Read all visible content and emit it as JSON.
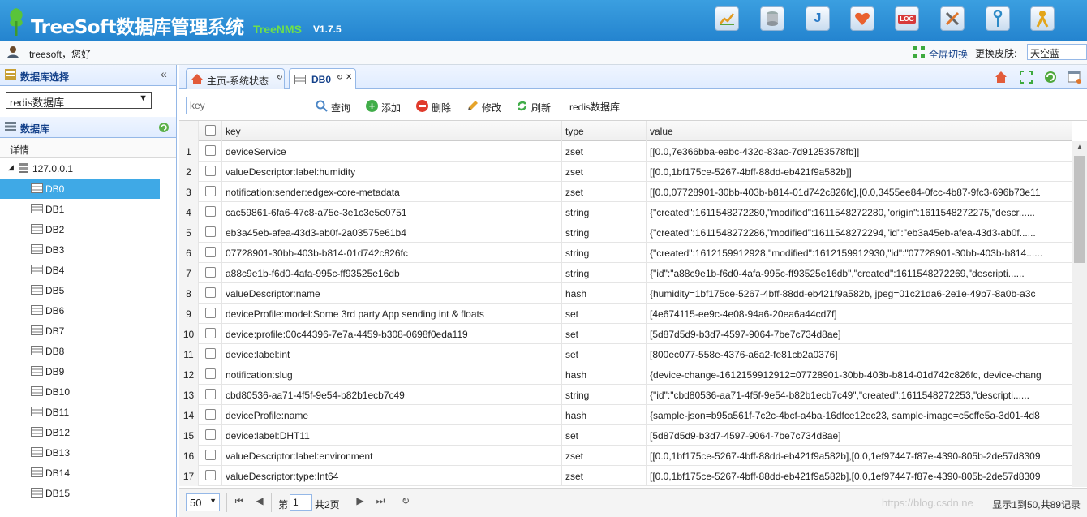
{
  "header": {
    "title": "TreeSoft数据库管理系统",
    "subtitle": "TreeNMS",
    "version": "V1.7.5",
    "toolbar_icons": [
      "chart-icon",
      "database-icon",
      "j-icon",
      "heart-icon",
      "log-icon",
      "tools-icon",
      "key-icon",
      "user-icon"
    ]
  },
  "userbar": {
    "username": "treesoft，您好",
    "fullscreen_label": "全屏切换",
    "skin_label": "更换皮肤:",
    "skin_value": "天空蓝"
  },
  "left": {
    "db_select_title": "数据库选择",
    "db_select_value": "redis数据库",
    "db_panel_title": "数据库",
    "detail_label": "详情",
    "root_node": "127.0.0.1",
    "dbs": [
      "DB0",
      "DB1",
      "DB2",
      "DB3",
      "DB4",
      "DB5",
      "DB6",
      "DB7",
      "DB8",
      "DB9",
      "DB10",
      "DB11",
      "DB12",
      "DB13",
      "DB14",
      "DB15"
    ],
    "selected": "DB0"
  },
  "tabs": [
    {
      "label": "主页-系统状态",
      "icon": "home-icon"
    },
    {
      "label": "DB0",
      "icon": "table-icon"
    }
  ],
  "toolbar": {
    "search_placeholder": "key",
    "query_label": "查询",
    "add_label": "添加",
    "delete_label": "删除",
    "edit_label": "修改",
    "refresh_label": "刷新",
    "db_name": "redis数据库"
  },
  "grid": {
    "columns": [
      "key",
      "type",
      "value"
    ],
    "rows": [
      {
        "n": "1",
        "key": "deviceService",
        "type": "zset",
        "value": "[[0.0,7e366bba-eabc-432d-83ac-7d91253578fb]]"
      },
      {
        "n": "2",
        "key": "valueDescriptor:label:humidity",
        "type": "zset",
        "value": "[[0.0,1bf175ce-5267-4bff-88dd-eb421f9a582b]]"
      },
      {
        "n": "3",
        "key": "notification:sender:edgex-core-metadata",
        "type": "zset",
        "value": "[[0.0,07728901-30bb-403b-b814-01d742c826fc],[0.0,3455ee84-0fcc-4b87-9fc3-696b73e11"
      },
      {
        "n": "4",
        "key": "cac59861-6fa6-47c8-a75e-3e1c3e5e0751",
        "type": "string",
        "value": "{\"created\":1611548272280,\"modified\":1611548272280,\"origin\":1611548272275,\"descr......"
      },
      {
        "n": "5",
        "key": "eb3a45eb-afea-43d3-ab0f-2a03575e61b4",
        "type": "string",
        "value": "{\"created\":1611548272286,\"modified\":1611548272294,\"id\":\"eb3a45eb-afea-43d3-ab0f......"
      },
      {
        "n": "6",
        "key": "07728901-30bb-403b-b814-01d742c826fc",
        "type": "string",
        "value": "{\"created\":1612159912928,\"modified\":1612159912930,\"id\":\"07728901-30bb-403b-b814......"
      },
      {
        "n": "7",
        "key": "a88c9e1b-f6d0-4afa-995c-ff93525e16db",
        "type": "string",
        "value": "{\"id\":\"a88c9e1b-f6d0-4afa-995c-ff93525e16db\",\"created\":1611548272269,\"descripti......"
      },
      {
        "n": "8",
        "key": "valueDescriptor:name",
        "type": "hash",
        "value": "{humidity=1bf175ce-5267-4bff-88dd-eb421f9a582b, jpeg=01c21da6-2e1e-49b7-8a0b-a3c"
      },
      {
        "n": "9",
        "key": "deviceProfile:model:Some 3rd party App sending int & floats",
        "type": "set",
        "value": "[4e674115-ee9c-4e08-94a6-20ea6a44cd7f]"
      },
      {
        "n": "10",
        "key": "device:profile:00c44396-7e7a-4459-b308-0698f0eda119",
        "type": "set",
        "value": "[5d87d5d9-b3d7-4597-9064-7be7c734d8ae]"
      },
      {
        "n": "11",
        "key": "device:label:int",
        "type": "set",
        "value": "[800ec077-558e-4376-a6a2-fe81cb2a0376]"
      },
      {
        "n": "12",
        "key": "notification:slug",
        "type": "hash",
        "value": "{device-change-1612159912912=07728901-30bb-403b-b814-01d742c826fc, device-chang"
      },
      {
        "n": "13",
        "key": "cbd80536-aa71-4f5f-9e54-b82b1ecb7c49",
        "type": "string",
        "value": "{\"id\":\"cbd80536-aa71-4f5f-9e54-b82b1ecb7c49\",\"created\":1611548272253,\"descripti......"
      },
      {
        "n": "14",
        "key": "deviceProfile:name",
        "type": "hash",
        "value": "{sample-json=b95a561f-7c2c-4bcf-a4ba-16dfce12ec23, sample-image=c5cffe5a-3d01-4d8"
      },
      {
        "n": "15",
        "key": "device:label:DHT11",
        "type": "set",
        "value": "[5d87d5d9-b3d7-4597-9064-7be7c734d8ae]"
      },
      {
        "n": "16",
        "key": "valueDescriptor:label:environment",
        "type": "zset",
        "value": "[[0.0,1bf175ce-5267-4bff-88dd-eb421f9a582b],[0.0,1ef97447-f87e-4390-805b-2de57d8309"
      },
      {
        "n": "17",
        "key": "valueDescriptor:type:Int64",
        "type": "zset",
        "value": "[[0.0,1bf175ce-5267-4bff-88dd-eb421f9a582b],[0.0,1ef97447-f87e-4390-805b-2de57d8309"
      }
    ]
  },
  "pager": {
    "page_size": "50",
    "page_prefix": "第",
    "page_value": "1",
    "page_total": "共2页",
    "watermark": "https://blog.csdn.ne",
    "info": "显示1到50,共89记录"
  }
}
